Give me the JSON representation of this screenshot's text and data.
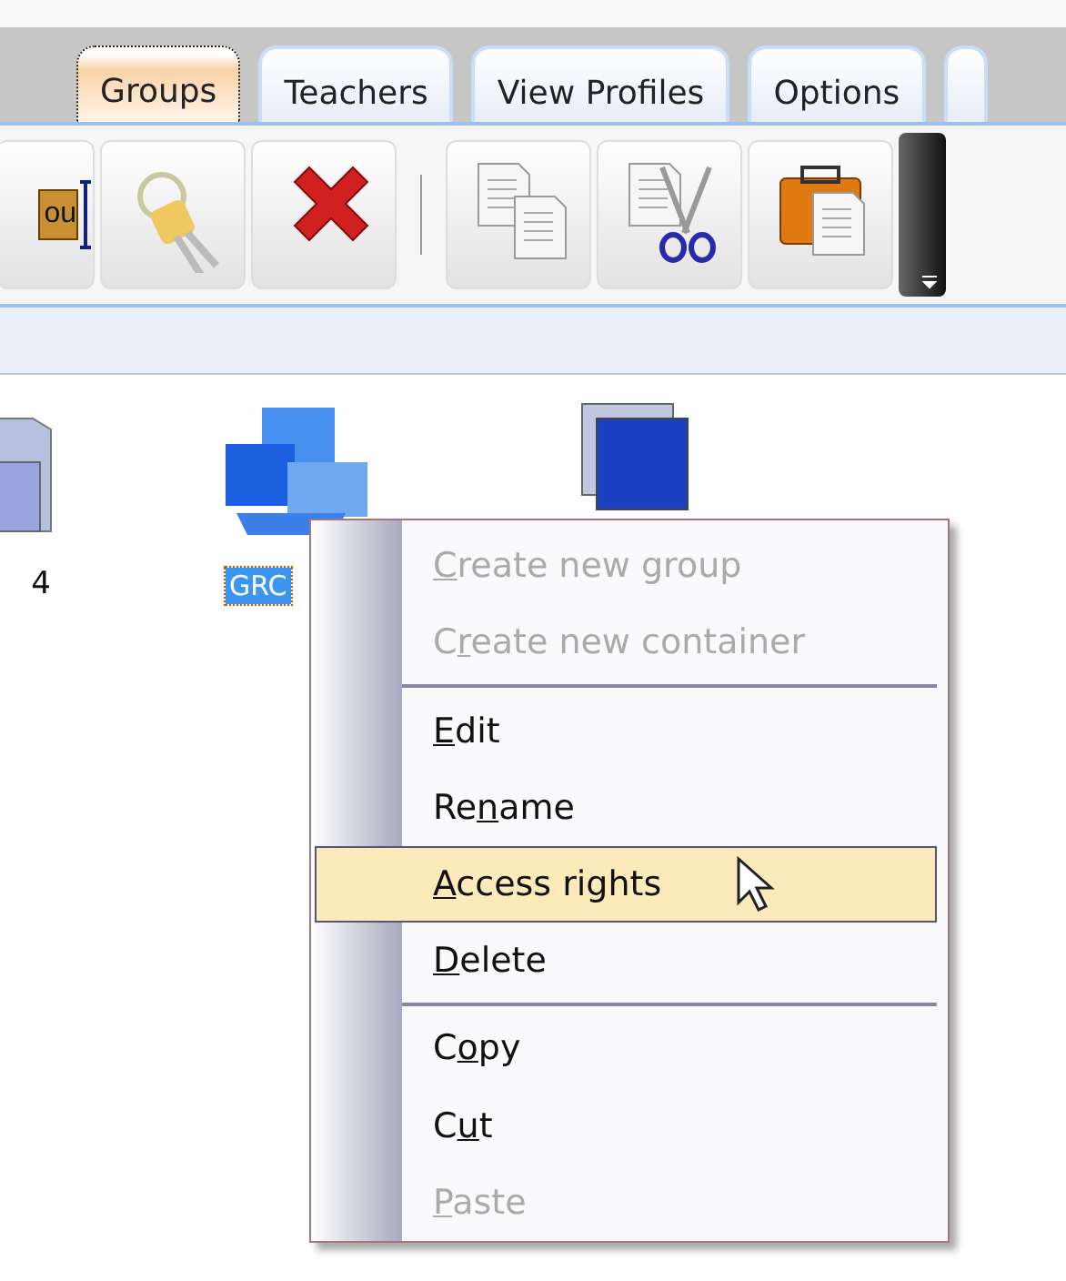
{
  "tabs": [
    {
      "label": "Groups",
      "selected": true
    },
    {
      "label": "Teachers",
      "selected": false
    },
    {
      "label": "View Profiles",
      "selected": false
    },
    {
      "label": "Options",
      "selected": false
    },
    {
      "selected": false
    }
  ],
  "toolbar": [
    {
      "kind": "text-widget",
      "text": "ou"
    },
    {
      "kind": "keys"
    },
    {
      "kind": "delete"
    },
    {
      "kind": "separator"
    },
    {
      "kind": "copy"
    },
    {
      "kind": "cut"
    },
    {
      "kind": "paste"
    },
    {
      "kind": "overflow"
    }
  ],
  "items": [
    {
      "kind": "folder",
      "label": "4",
      "selected": false
    },
    {
      "kind": "group",
      "label": "GRC",
      "selected": true
    },
    {
      "kind": "container"
    }
  ],
  "context_menu": {
    "entries": [
      {
        "kind": "item",
        "key": "C",
        "after": "reate new group",
        "disabled": true,
        "selected": false
      },
      {
        "kind": "item",
        "before": "C",
        "key": "r",
        "after": "eate new container",
        "disabled": true,
        "selected": false
      },
      {
        "kind": "separator"
      },
      {
        "kind": "item",
        "key": "E",
        "after": "dit",
        "disabled": false,
        "selected": false
      },
      {
        "kind": "item",
        "before": "Re",
        "key": "n",
        "after": "ame",
        "disabled": false,
        "selected": false
      },
      {
        "kind": "item",
        "key": "A",
        "after": "ccess rights",
        "disabled": false,
        "selected": true
      },
      {
        "kind": "item",
        "key": "D",
        "after": "elete",
        "disabled": false,
        "selected": false
      },
      {
        "kind": "separator"
      },
      {
        "kind": "item",
        "before": "C",
        "key": "o",
        "after": "py",
        "disabled": false,
        "selected": false
      },
      {
        "kind": "item",
        "before": "C",
        "key": "u",
        "after": "t",
        "disabled": false,
        "selected": false
      },
      {
        "kind": "item",
        "key": "P",
        "after": "aste",
        "disabled": true,
        "selected": false
      }
    ]
  }
}
